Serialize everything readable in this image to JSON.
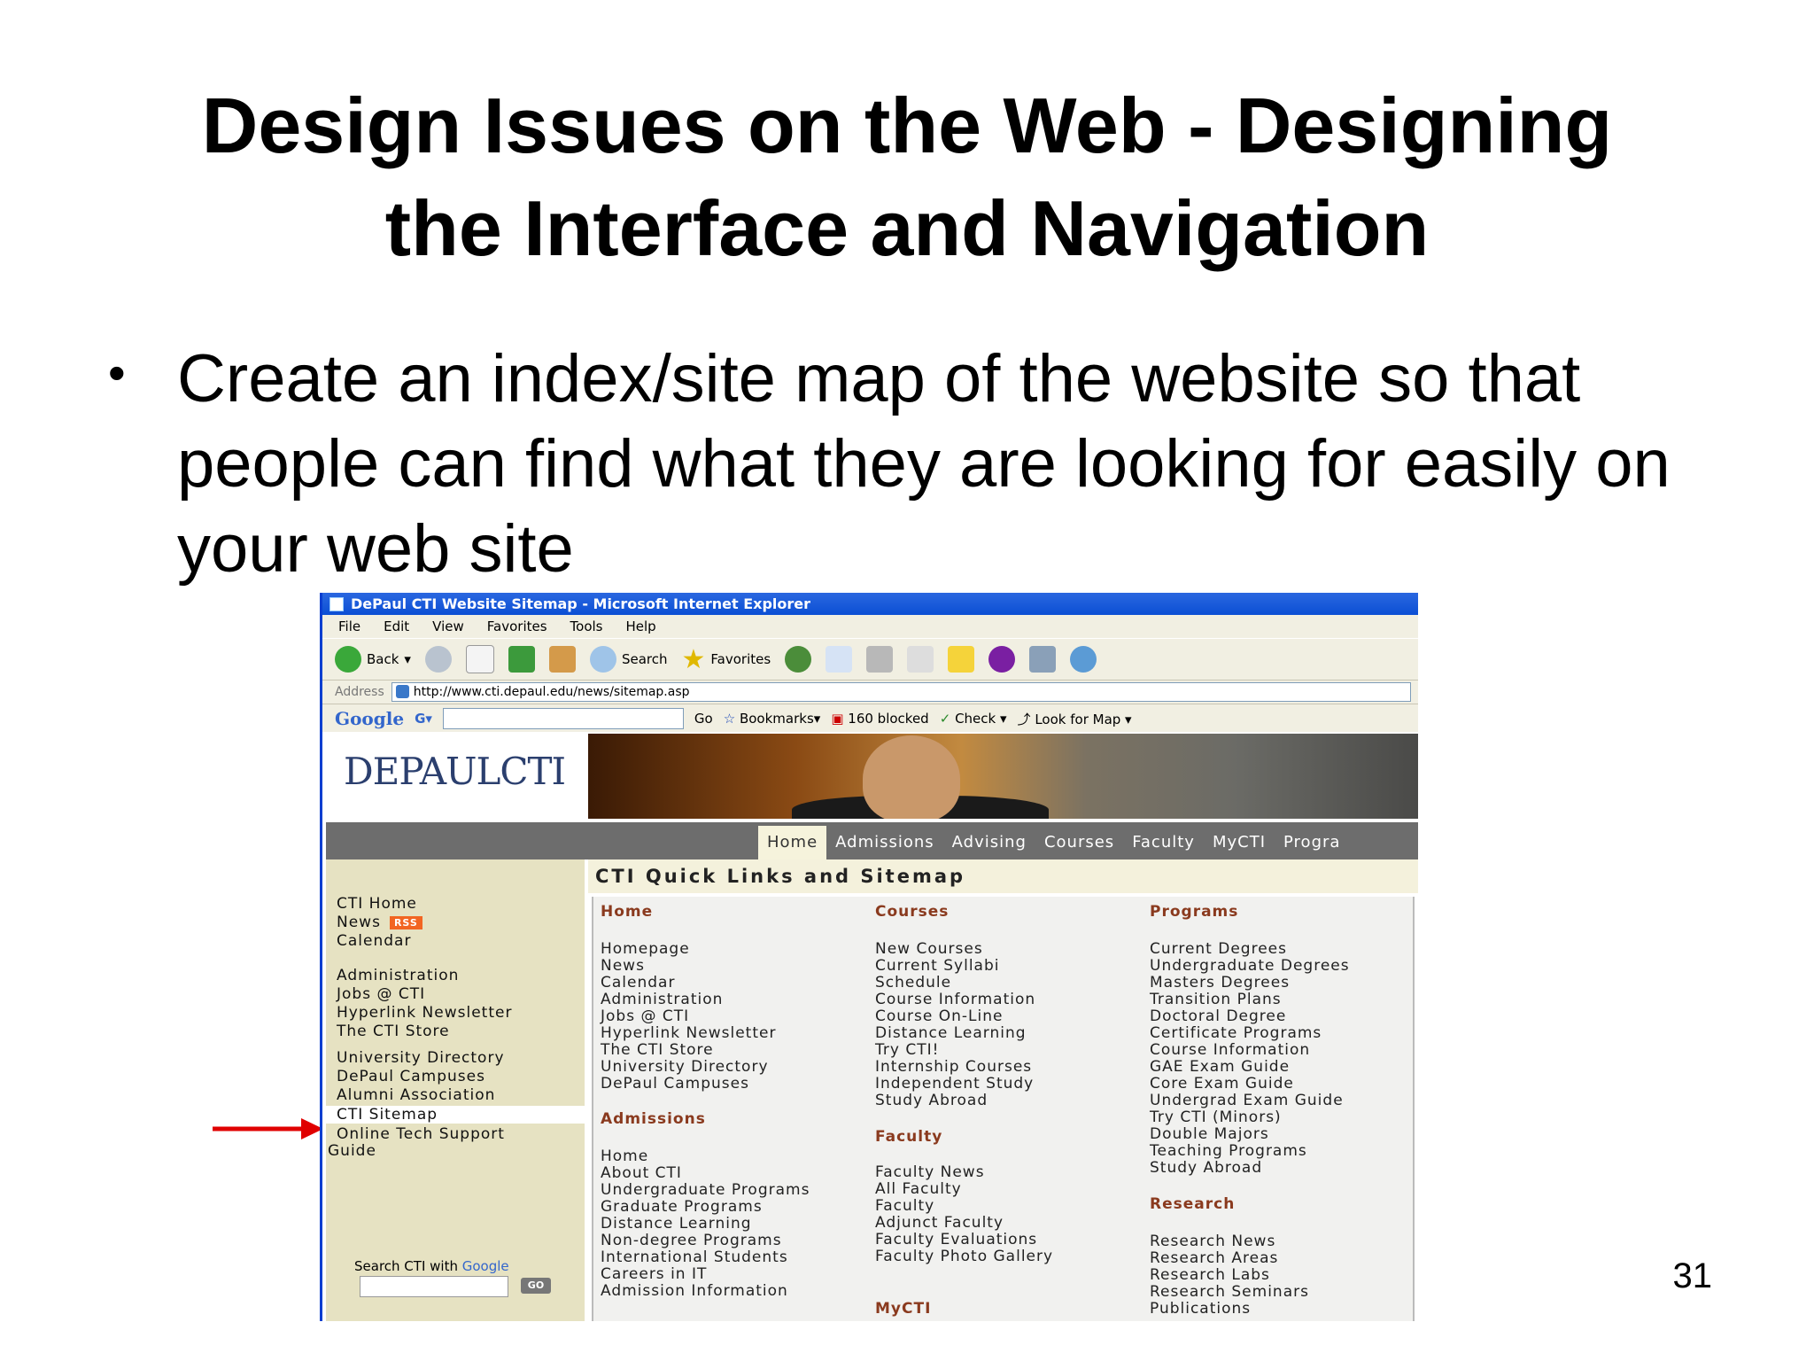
{
  "slide": {
    "title_line1": "Design Issues on the Web - Designing",
    "title_line2": "the Interface and Navigation",
    "bullet": "Create an index/site map of the website so that people can find what they are looking for easily on your web site",
    "page_number": "31"
  },
  "browser": {
    "window_title": "DePaul CTI Website Sitemap - Microsoft Internet Explorer",
    "menu": [
      "File",
      "Edit",
      "View",
      "Favorites",
      "Tools",
      "Help"
    ],
    "toolbar": {
      "back": "Back",
      "search": "Search",
      "favorites": "Favorites"
    },
    "address_label": "Address",
    "address_url": "http://www.cti.depaul.edu/news/sitemap.asp",
    "google_bar": {
      "logo": "Google",
      "g_button": "G",
      "go": "Go",
      "bookmarks": "Bookmarks",
      "blocked": "160 blocked",
      "check": "Check",
      "look_for_map": "Look for Map"
    }
  },
  "site": {
    "logo": "DEPAULCTI",
    "nav_tabs": [
      "Home",
      "Admissions",
      "Advising",
      "Courses",
      "Faculty",
      "MyCTI",
      "Progra"
    ],
    "left_nav": [
      {
        "label": "CTI Home"
      },
      {
        "label": "News",
        "badge": "RSS"
      },
      {
        "label": "Calendar"
      },
      {
        "label": "Administration"
      },
      {
        "label": "Jobs @ CTI"
      },
      {
        "label": "Hyperlink Newsletter"
      },
      {
        "label": "The CTI Store"
      },
      {
        "label": "University Directory"
      },
      {
        "label": "DePaul Campuses"
      },
      {
        "label": "Alumni Association"
      },
      {
        "label": "CTI Sitemap",
        "selected": true
      },
      {
        "label": "Online Tech Support"
      },
      {
        "label": "Guide"
      }
    ],
    "search_label_prefix": "Search CTI with",
    "search_label_brand": "Google",
    "search_go": "GO",
    "main_title": "CTI Quick Links and Sitemap",
    "sitemap": {
      "home_head": "Home",
      "home_items": [
        "Homepage",
        "News",
        "Calendar",
        "Administration",
        "Jobs @ CTI",
        "Hyperlink Newsletter",
        "The CTI Store",
        "University Directory",
        "DePaul Campuses"
      ],
      "admissions_head": "Admissions",
      "admissions_items": [
        "Home",
        "About CTI",
        "Undergraduate Programs",
        "Graduate Programs",
        "Distance Learning",
        "Non-degree Programs",
        "International Students",
        "Careers in IT",
        "Admission Information"
      ],
      "courses_head": "Courses",
      "courses_items": [
        "New Courses",
        "Current Syllabi",
        "Schedule",
        "Course Information",
        "Course On-Line",
        "Distance Learning",
        "Try CTI!",
        "Internship Courses",
        "Independent Study",
        "Study Abroad"
      ],
      "faculty_head": "Faculty",
      "faculty_items": [
        "Faculty News",
        "All Faculty",
        "Faculty",
        "Adjunct Faculty",
        "Faculty Evaluations",
        "Faculty Photo Gallery"
      ],
      "mycti_head": "MyCTI",
      "programs_head": "Programs",
      "programs_items": [
        "Current Degrees",
        "Undergraduate Degrees",
        "Masters Degrees",
        "Transition Plans",
        "Doctoral Degree",
        "Certificate Programs",
        "Course Information",
        "GAE Exam Guide",
        "Core Exam Guide",
        "Undergrad Exam Guide",
        "Try CTI (Minors)",
        "Double Majors",
        "Teaching Programs",
        "Study Abroad"
      ],
      "research_head": "Research",
      "research_items": [
        "Research News",
        "Research Areas",
        "Research Labs",
        "Research Seminars",
        "Publications"
      ]
    }
  },
  "colors": {
    "accent_heading": "#8a3a1e",
    "nav_bg": "#6d6d6d",
    "left_bg": "#e6e2c2",
    "arrow": "#e00000"
  },
  "icons": [
    "back-icon",
    "forward-icon",
    "stop-icon",
    "refresh-icon",
    "home-icon",
    "search-icon",
    "favorites-star-icon",
    "media-icon",
    "mail-icon",
    "print-icon",
    "edit-icon",
    "messenger-icon",
    "red-arrow-icon"
  ]
}
